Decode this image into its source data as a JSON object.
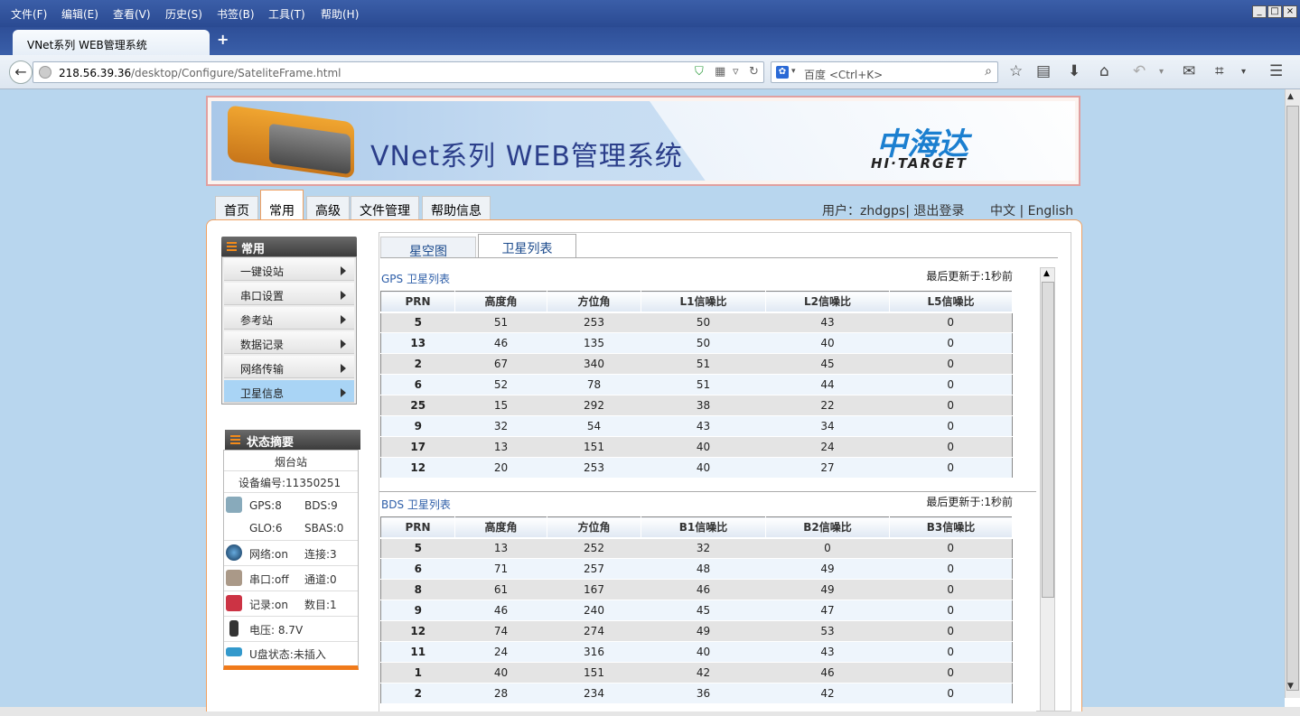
{
  "browser": {
    "menu": [
      "文件(F)",
      "编辑(E)",
      "查看(V)",
      "历史(S)",
      "书签(B)",
      "工具(T)",
      "帮助(H)"
    ],
    "tab_title": "VNet系列 WEB管理系统",
    "new_tab": "+",
    "url_host": "218.56.39.36",
    "url_path": "/desktop/Configure/SateliteFrame.html",
    "search_engine": "百度",
    "search_placeholder": "<Ctrl+K>"
  },
  "banner": {
    "title": "VNet系列 WEB管理系统",
    "logo_cn": "中海达",
    "logo_en": "HI·TARGET"
  },
  "nav": {
    "tabs": [
      "首页",
      "常用",
      "高级",
      "文件管理",
      "帮助信息"
    ],
    "active": "常用",
    "user_label": "用户：",
    "user_name": "zhdgps",
    "logout": "| 退出登录",
    "lang_cn": "中文",
    "lang_sep": "|",
    "lang_en": "English"
  },
  "sidebar": {
    "header": "常用",
    "items": [
      "一键设站",
      "串口设置",
      "参考站",
      "数据记录",
      "网络传输",
      "卫星信息"
    ],
    "selected": "卫星信息"
  },
  "status": {
    "header": "状态摘要",
    "station": "烟台站",
    "device_no": "设备编号:11350251",
    "gps": "GPS:8",
    "bds": "BDS:9",
    "glo": "GLO:6",
    "sbas": "SBAS:0",
    "network": "网络:on",
    "connections": "连接:3",
    "serial": "串口:off",
    "channel": "通道:0",
    "record": "记录:on",
    "count": "数目:1",
    "voltage": "电压: 8.7V",
    "usb": "U盘状态:未插入"
  },
  "panel": {
    "tabs": [
      "星空图",
      "卫星列表"
    ],
    "active_tab": "卫星列表"
  },
  "gps": {
    "title": "GPS 卫星列表",
    "updated": "最后更新于:1秒前",
    "headers": [
      "PRN",
      "高度角",
      "方位角",
      "L1信噪比",
      "L2信噪比",
      "L5信噪比"
    ],
    "rows": [
      [
        "5",
        "51",
        "253",
        "50",
        "43",
        "0"
      ],
      [
        "13",
        "46",
        "135",
        "50",
        "40",
        "0"
      ],
      [
        "2",
        "67",
        "340",
        "51",
        "45",
        "0"
      ],
      [
        "6",
        "52",
        "78",
        "51",
        "44",
        "0"
      ],
      [
        "25",
        "15",
        "292",
        "38",
        "22",
        "0"
      ],
      [
        "9",
        "32",
        "54",
        "43",
        "34",
        "0"
      ],
      [
        "17",
        "13",
        "151",
        "40",
        "24",
        "0"
      ],
      [
        "12",
        "20",
        "253",
        "40",
        "27",
        "0"
      ]
    ]
  },
  "bds": {
    "title": "BDS 卫星列表",
    "updated": "最后更新于:1秒前",
    "headers": [
      "PRN",
      "高度角",
      "方位角",
      "B1信噪比",
      "B2信噪比",
      "B3信噪比"
    ],
    "rows": [
      [
        "5",
        "13",
        "252",
        "32",
        "0",
        "0"
      ],
      [
        "6",
        "71",
        "257",
        "48",
        "49",
        "0"
      ],
      [
        "8",
        "61",
        "167",
        "46",
        "49",
        "0"
      ],
      [
        "9",
        "46",
        "240",
        "45",
        "47",
        "0"
      ],
      [
        "12",
        "74",
        "274",
        "49",
        "53",
        "0"
      ],
      [
        "11",
        "24",
        "316",
        "40",
        "43",
        "0"
      ],
      [
        "1",
        "40",
        "151",
        "42",
        "46",
        "0"
      ],
      [
        "2",
        "28",
        "234",
        "36",
        "42",
        "0"
      ]
    ]
  }
}
